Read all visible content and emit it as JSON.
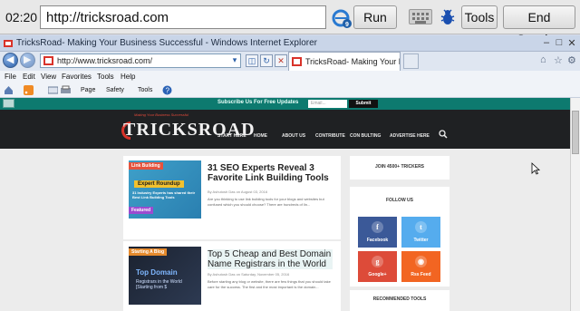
{
  "remote_bar": {
    "timer": "02:20",
    "url": "http://tricksroad.com",
    "run_label": "Run",
    "tools_label": "Tools",
    "end_session_label": "End Session"
  },
  "ie_window": {
    "title": "TricksRoad- Making Your Business Successful - Windows Internet Explorer",
    "address": "http://www.tricksroad.com/",
    "tab_label": "TricksRoad- Making Your Busi...",
    "menu": [
      "File",
      "Edit",
      "View",
      "Favorites",
      "Tools",
      "Help"
    ],
    "command_bar": [
      "Page",
      "Safety",
      "Tools"
    ]
  },
  "page": {
    "subscribe_text": "Subscribe Us For Free Updates",
    "subscribe_placeholder": "Email...",
    "submit_label": "Submit",
    "logo_tagline": "Making Your Business Successful",
    "logo_text": "TRICKSROAD",
    "nav": [
      "START HERE",
      "HOME",
      "ABOUT US",
      "CONTRIBUTE",
      "CON BULTING",
      "ADVERTISE HERE"
    ],
    "posts": [
      {
        "category": "Link Building",
        "image_heading": "Expert Roundup",
        "image_text": "31 Industry Experts has shared their Best Link Building Tools",
        "badge": "Featured",
        "title": "31 SEO Experts Reveal 3 Favorite Link Building Tools",
        "meta": "By Ashutosh Das on August 03, 2016",
        "excerpt": "Are you thinking to use link building tools for your blogs and websites but confused which you should choose? There are hundreds of lin..."
      },
      {
        "category": "Starting A Blog",
        "image_heading": "Top Domain",
        "image_text": "Registrars in the World [Starting from $",
        "title": "Top 5 Cheap and Best Domain Name Registrars in the World",
        "meta": "By Ashutosh Das on Saturday, November 05, 2016",
        "excerpt": "Before starting any blog or website, there are few things that you should take care for the success. The first and the most important is the domain..."
      }
    ],
    "sidebar": {
      "join_text": "JOIN 4500+ TRICKERS",
      "follow_heading": "FOLLOW US",
      "social": [
        "Facebook",
        "Twitter",
        "Google+",
        "Rss Feed"
      ],
      "recommended_heading": "RECOMMENDED TOOLS"
    }
  },
  "colors": {
    "teal": "#0d7a6f",
    "header_dark": "#1f2123",
    "facebook": "#3b5998",
    "twitter": "#55acee",
    "google": "#dd4b39",
    "rss": "#f26522"
  }
}
